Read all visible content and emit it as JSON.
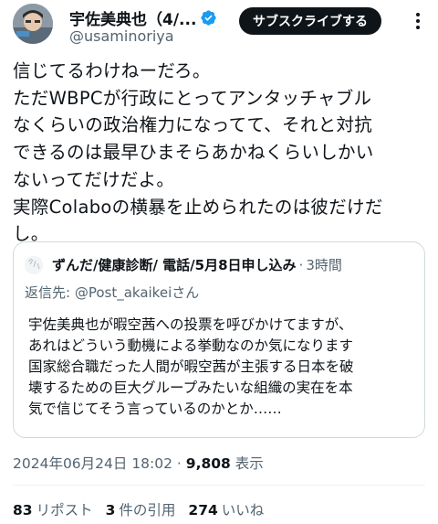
{
  "author": {
    "name": "宇佐美典也（4/...",
    "handle": "@usaminoriya",
    "subscribe_label": "サブスクライブする"
  },
  "tweet": {
    "lines": [
      "信じてるわけねーだろ。",
      "ただWBPCが行政にとってアンタッチャブル",
      "なくらいの政治権力になってて、それと対抗",
      "できるのは最早ひまそらあかねくらいしかい",
      "ないってだけだよ。",
      "実際Colaboの横暴を止められたのは彼だけだ",
      "し。"
    ]
  },
  "quote": {
    "name": "ずんだ/健康診断/ 電話/5月8日申し込み",
    "separator": "·",
    "time": "3時間",
    "reply_prefix": "返信先: ",
    "reply_handle": "@Post_akaikei",
    "reply_suffix": "さん",
    "lines": [
      "宇佐美典也が暇空茜への投票を呼びかけてますが、",
      "あれはどういう動機による挙動なのか気になります",
      "国家総合職だった人間が暇空茜が主張する日本を破",
      "壊するための巨大グループみたいな組織の実在を本",
      "気で信じてそう言っているのかとか……"
    ]
  },
  "meta": {
    "datetime": "2024年06月24日 18:02",
    "separator": " · ",
    "views": "9,808",
    "views_label": " 表示"
  },
  "stats": {
    "reposts_count": "83",
    "reposts_label": "リポスト",
    "quotes_count": "3",
    "quotes_label": "件の引用",
    "likes_count": "274",
    "likes_label": "いいね"
  },
  "colors": {
    "verified": "#1d9bf0",
    "text": "#0f1419",
    "secondary": "#536471",
    "border": "#cfd9de"
  }
}
